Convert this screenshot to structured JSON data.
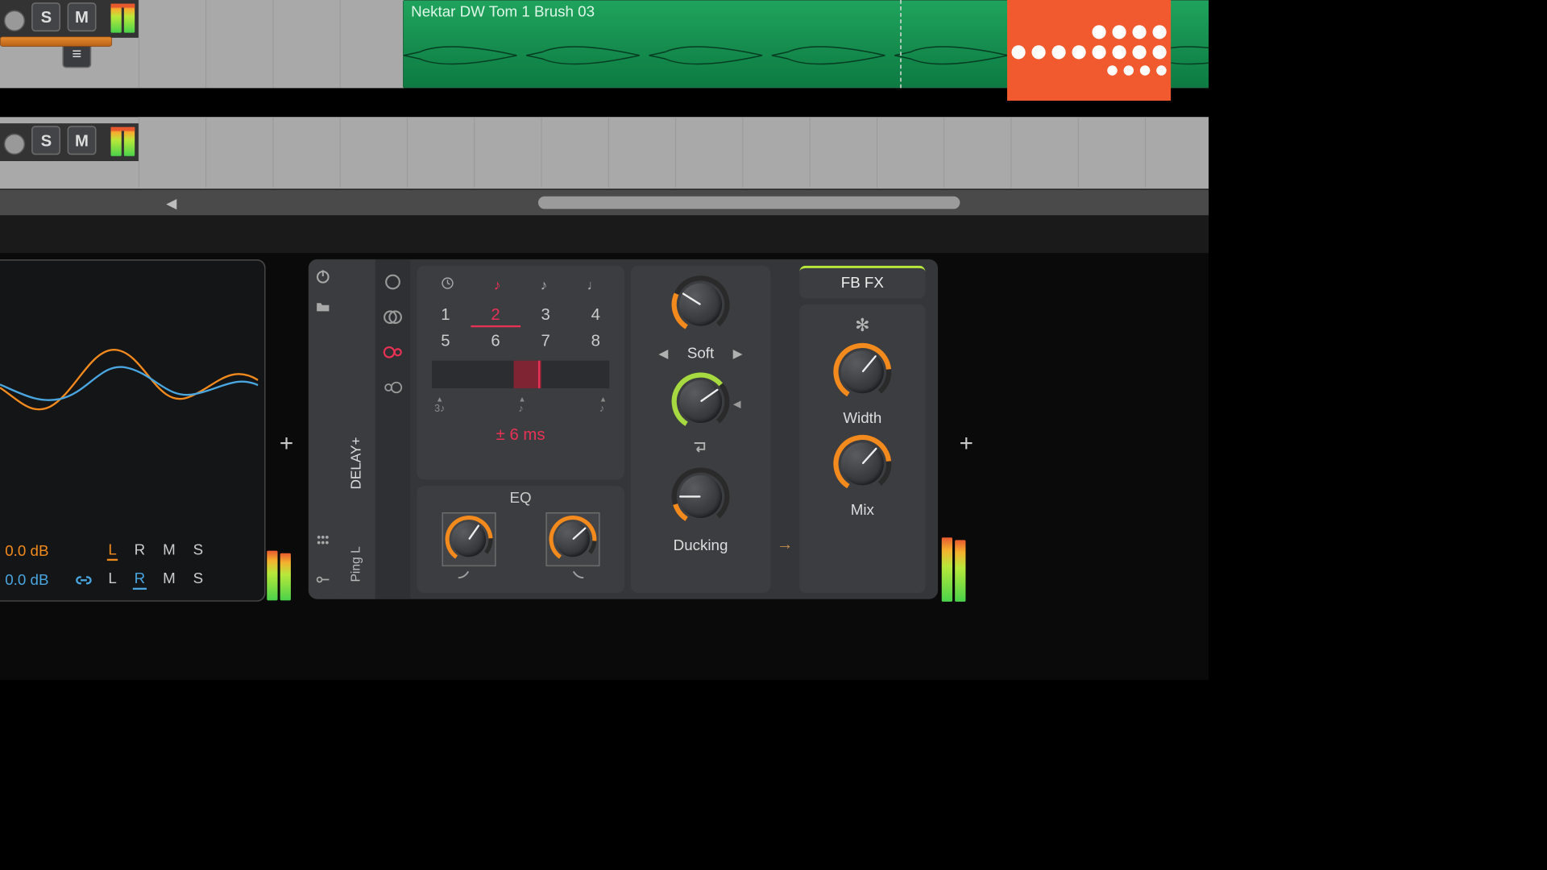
{
  "clip": {
    "name": "Nektar DW Tom 1 Brush 03"
  },
  "track_controls": {
    "solo": "S",
    "mute": "M"
  },
  "analyser": {
    "left": {
      "db": "0.0 dB",
      "lrms": [
        "L",
        "R",
        "M",
        "S"
      ],
      "active": "L",
      "color": "#f38a1e"
    },
    "right": {
      "db": "0.0 dB",
      "lrms": [
        "L",
        "R",
        "M",
        "S"
      ],
      "active": "R",
      "color": "#4aa6e0"
    }
  },
  "delay": {
    "title": "DELAY+",
    "subtitle": "Ping L",
    "note_row": [
      "clock",
      "eighth-dotted",
      "eighth",
      "quarter"
    ],
    "note_selected": 1,
    "numbers": [
      "1",
      "2",
      "3",
      "4",
      "5",
      "6",
      "7",
      "8"
    ],
    "number_selected": "2",
    "offset_readout": "±  6 ms",
    "eq_title": "EQ",
    "soft_label": "Soft",
    "ducking_label": "Ducking",
    "width_label": "Width",
    "mix_label": "Mix",
    "fbfx_label": "FB FX"
  }
}
